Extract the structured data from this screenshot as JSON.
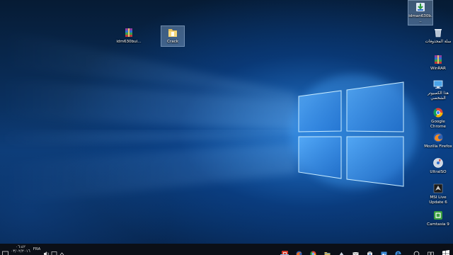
{
  "desktop": {
    "icons_left": [
      {
        "name": "idm-build-icon",
        "label": "idm630bui..."
      },
      {
        "name": "crack-folder-icon",
        "label": "Crack"
      }
    ],
    "icons_right": [
      {
        "label": "idman630b..."
      },
      {
        "label": "سلة المحذوفات"
      },
      {
        "label": "WinRAR"
      },
      {
        "label": "هذا الكمبيوتر الشخصي"
      },
      {
        "label": "Google Chrome"
      },
      {
        "label": "Mozilla Firefox"
      },
      {
        "label": "UltraISO"
      },
      {
        "label": "MSI Live Update 6"
      },
      {
        "label": "Camtasia 9"
      }
    ]
  },
  "taskbar": {
    "clock_time": "٠٦:٤٢",
    "clock_date": "٠٣/٠٢/٢٠١٦",
    "language": "FRA",
    "pinned": [
      {
        "name": "camtasia-app-icon",
        "color": "#d23a2a"
      },
      {
        "name": "firefox-app-icon",
        "color": "#e8691c"
      },
      {
        "name": "chrome-app-icon",
        "color": "#2f9e41"
      },
      {
        "name": "file-explorer-icon",
        "color": "#f2c14e"
      },
      {
        "name": "people-app-icon",
        "color": "#c9d3df"
      },
      {
        "name": "mail-app-icon",
        "color": "#e8e8e8"
      },
      {
        "name": "store-app-icon",
        "color": "#e8e8e8"
      },
      {
        "name": "pictures-app-icon",
        "color": "#3f8bd6"
      },
      {
        "name": "edge-app-icon",
        "color": "#3c8fe0"
      }
    ]
  },
  "colors": {
    "accent": "#1f6fd1",
    "taskbar_bg": "#0b0f17",
    "glow": "#9fd4ff"
  }
}
